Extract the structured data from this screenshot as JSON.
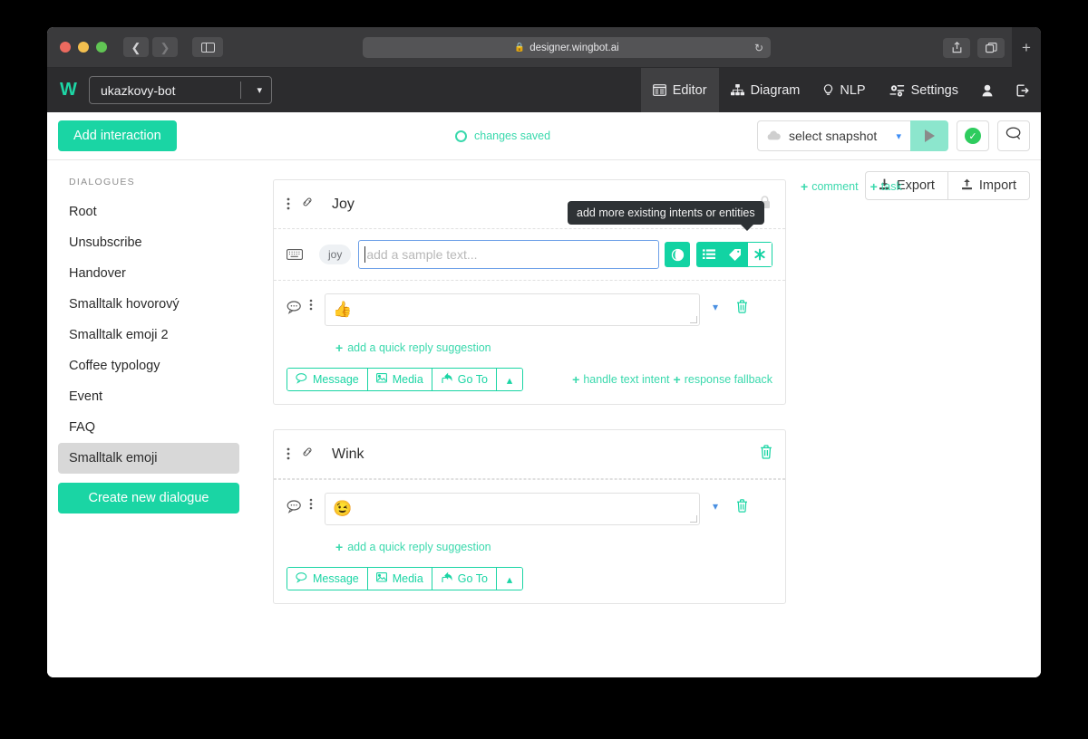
{
  "browser": {
    "url": "designer.wingbot.ai",
    "lock_icon": "lock-icon",
    "reload_icon": "reload-icon",
    "back_icon": "back-arrow-icon",
    "forward_icon": "forward-arrow-icon",
    "sidebar_icon": "sidebar-toggle-icon",
    "share_icon": "share-icon",
    "tabs_icon": "tab-overview-icon",
    "new_tab_icon": "plus-icon"
  },
  "app_header": {
    "logo": "W",
    "bot_name": "ukazkovy-bot",
    "nav": [
      {
        "label": "Editor",
        "icon": "editor-icon",
        "active": true
      },
      {
        "label": "Diagram",
        "icon": "diagram-icon",
        "active": false
      },
      {
        "label": "NLP",
        "icon": "nlp-bulb-icon",
        "active": false
      },
      {
        "label": "Settings",
        "icon": "gear-icon",
        "active": false
      }
    ],
    "account_icon": "user-icon",
    "logout_icon": "logout-icon"
  },
  "toolbar": {
    "add_interaction_label": "Add interaction",
    "status_text": "changes saved",
    "status_icon": "circle-outline-icon",
    "snapshot_placeholder": "select snapshot",
    "snapshot_icon": "cloud-upload-icon",
    "snapshot_caret": "chevron-down-icon",
    "play_icon": "play-icon",
    "validate_icon": "check-circle-icon",
    "chat_icon": "chat-bubble-icon",
    "accent_color": "#1ad5a4"
  },
  "sidebar": {
    "heading": "DIALOGUES",
    "items": [
      {
        "label": "Root",
        "selected": false
      },
      {
        "label": "Unsubscribe",
        "selected": false
      },
      {
        "label": "Handover",
        "selected": false
      },
      {
        "label": "Smalltalk hovorový",
        "selected": false
      },
      {
        "label": "Smalltalk emoji 2",
        "selected": false
      },
      {
        "label": "Coffee typology",
        "selected": false
      },
      {
        "label": "Event",
        "selected": false
      },
      {
        "label": "FAQ",
        "selected": false
      },
      {
        "label": "Smalltalk emoji",
        "selected": true
      }
    ],
    "create_button_label": "Create new dialogue"
  },
  "main": {
    "export_label": "Export",
    "export_icon": "download-icon",
    "import_label": "Import",
    "import_icon": "upload-icon",
    "side_links": [
      {
        "label": "comment",
        "icon": "plus-icon"
      },
      {
        "label": "task",
        "icon": "plus-icon"
      }
    ],
    "tooltip": "add more existing intents or entities",
    "cards": [
      {
        "title": "Joy",
        "kebab_icon": "more-vertical-icon",
        "link_icon": "chain-link-icon",
        "lock_icon": "lock-icon",
        "intent": {
          "keyboard_icon": "keyboard-icon",
          "chip": "joy",
          "input_value": "",
          "input_placeholder": "add a sample text...",
          "buttons": [
            {
              "icon": "ai-detect-icon",
              "style": "solid"
            },
            {
              "icon": "list-icon",
              "style": "solid"
            },
            {
              "icon": "tag-icon",
              "style": "solid"
            },
            {
              "icon": "asterisk-icon",
              "style": "ghost"
            }
          ]
        },
        "message": {
          "bubble_icon": "speech-bubble-icon",
          "kebab_icon": "more-vertical-icon",
          "text": "👍",
          "chevron_icon": "chevron-down-icon",
          "delete_icon": "trash-icon"
        },
        "quick_reply_label": "add a quick reply suggestion",
        "quick_reply_icon": "plus-icon",
        "action_buttons": [
          {
            "label": "Message",
            "icon": "speech-bubble-icon"
          },
          {
            "label": "Media",
            "icon": "image-icon"
          },
          {
            "label": "Go To",
            "icon": "goto-icon"
          },
          {
            "label": "",
            "icon": "chevron-up-icon"
          }
        ],
        "action_links": [
          {
            "label": "handle text intent",
            "icon": "plus-icon"
          },
          {
            "label": "response fallback",
            "icon": "plus-icon"
          }
        ]
      },
      {
        "title": "Wink",
        "kebab_icon": "more-vertical-icon",
        "link_icon": "chain-link-icon",
        "delete_icon": "trash-icon",
        "message": {
          "bubble_icon": "speech-bubble-icon",
          "kebab_icon": "more-vertical-icon",
          "text": "😉",
          "chevron_icon": "chevron-down-icon",
          "delete_icon": "trash-icon"
        },
        "quick_reply_label": "add a quick reply suggestion",
        "quick_reply_icon": "plus-icon",
        "action_buttons": [
          {
            "label": "Message",
            "icon": "speech-bubble-icon"
          },
          {
            "label": "Media",
            "icon": "image-icon"
          },
          {
            "label": "Go To",
            "icon": "goto-icon"
          },
          {
            "label": "",
            "icon": "chevron-up-icon"
          }
        ]
      }
    ]
  }
}
